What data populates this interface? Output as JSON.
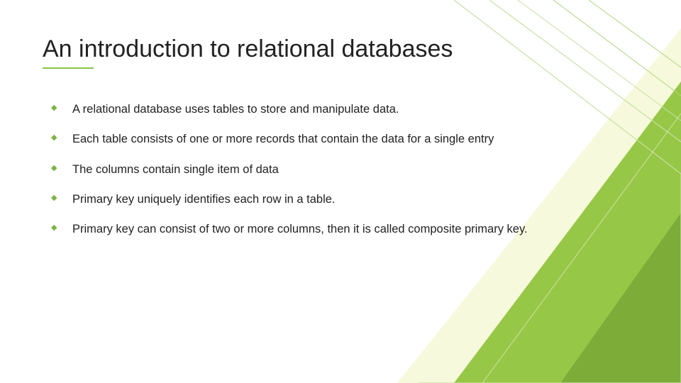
{
  "slide": {
    "title": "An introduction to relational databases",
    "bullets": [
      "A relational database uses tables to store and manipulate data.",
      "Each table consists of one or more records that contain the data for a single entry",
      "The columns contain single item of data",
      "Primary key uniquely identifies each row in a table.",
      "Primary key can consist of two or more columns, then it is called composite primary key."
    ]
  },
  "theme": {
    "accent": "#8bc34a",
    "accent_dark": "#7cb342",
    "accent_darker": "#689f38"
  }
}
